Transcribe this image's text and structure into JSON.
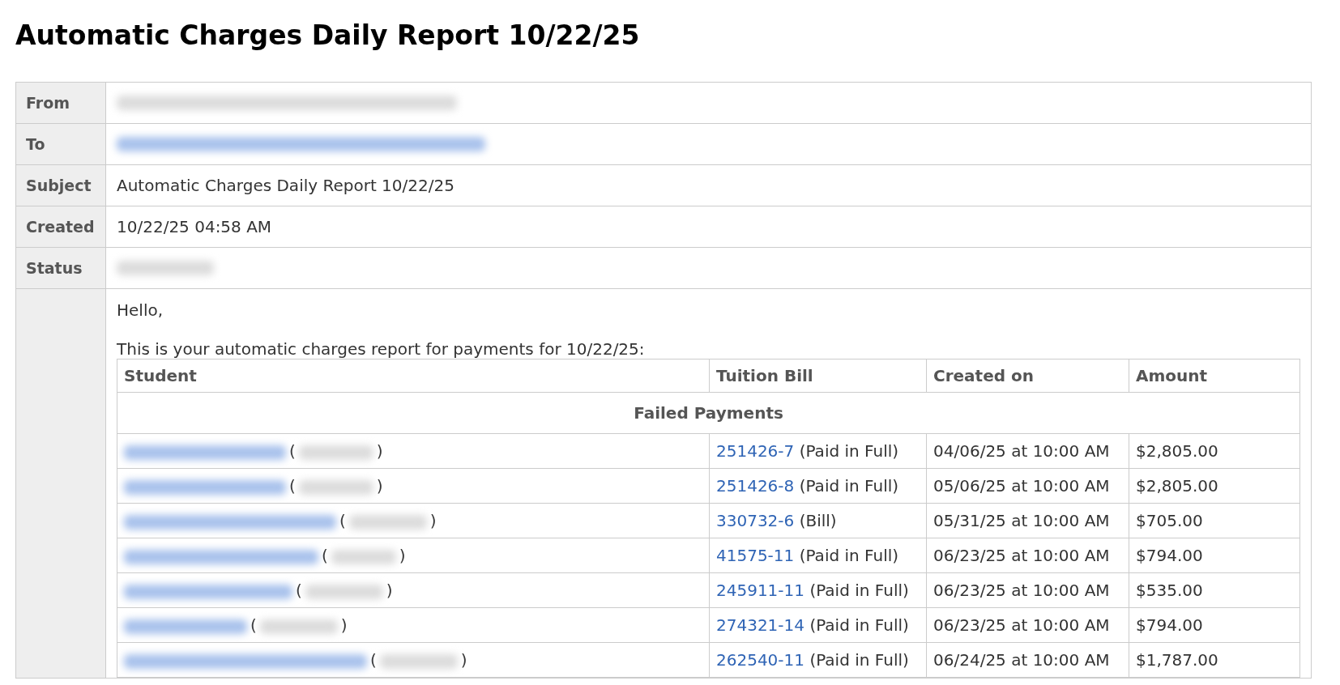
{
  "title": "Automatic Charges Daily Report 10/22/25",
  "fields": [
    {
      "label": "From",
      "redacted": true,
      "link": false
    },
    {
      "label": "To",
      "redacted": true,
      "link": true
    },
    {
      "label": "Subject",
      "value": "Automatic Charges Daily Report 10/22/25"
    },
    {
      "label": "Created",
      "value": "10/22/25 04:58 AM"
    },
    {
      "label": "Status",
      "redacted": true,
      "link": false
    }
  ],
  "body": {
    "greeting": "Hello,",
    "intro": "This is your automatic charges report for payments for 10/22/25:",
    "table": {
      "columns": [
        "Student",
        "Tuition Bill",
        "Created on",
        "Amount"
      ],
      "section": "Failed Payments",
      "rows": [
        {
          "student_redacted": true,
          "id_open": "(",
          "id_close": ")",
          "bill": "251426-7",
          "bill_status": "(Paid in Full)",
          "created_on": "04/06/25 at 10:00 AM",
          "amount": "$2,805.00"
        },
        {
          "student_redacted": true,
          "id_open": "(",
          "id_close": ")",
          "bill": "251426-8",
          "bill_status": "(Paid in Full)",
          "created_on": "05/06/25 at 10:00 AM",
          "amount": "$2,805.00"
        },
        {
          "student_redacted": true,
          "id_open": "(",
          "id_close": ")",
          "bill": "330732-6",
          "bill_status": "(Bill)",
          "created_on": "05/31/25 at 10:00 AM",
          "amount": "$705.00"
        },
        {
          "student_redacted": true,
          "id_open": "(",
          "id_close": ")",
          "bill": "41575-11",
          "bill_status": "(Paid in Full)",
          "created_on": "06/23/25 at 10:00 AM",
          "amount": "$794.00"
        },
        {
          "student_redacted": true,
          "id_open": "(",
          "id_close": ")",
          "bill": "245911-11",
          "bill_status": "(Paid in Full)",
          "created_on": "06/23/25 at 10:00 AM",
          "amount": "$535.00"
        },
        {
          "student_redacted": true,
          "id_open": "(",
          "id_close": ")",
          "bill": "274321-14",
          "bill_status": "(Paid in Full)",
          "created_on": "06/23/25 at 10:00 AM",
          "amount": "$794.00"
        },
        {
          "student_redacted": true,
          "id_open": "(",
          "id_close": ")",
          "bill": "262540-11",
          "bill_status": "(Paid in Full)",
          "created_on": "06/24/25 at 10:00 AM",
          "amount": "$1,787.00"
        }
      ]
    }
  }
}
